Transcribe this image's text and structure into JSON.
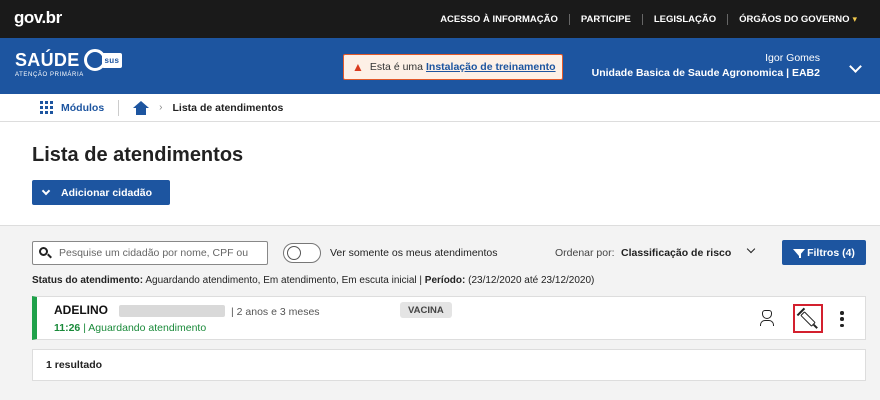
{
  "gov": {
    "logo": "gov.br",
    "links": [
      "ACESSO À INFORMAÇÃO",
      "PARTICIPE",
      "LEGISLAÇÃO",
      "ÓRGÃOS DO GOVERNO"
    ]
  },
  "brand": {
    "name": "SAÚDE",
    "esus": "sus",
    "subtitle": "ATENÇÃO PRIMÁRIA"
  },
  "training": {
    "prefix": "Esta é uma",
    "link": "Instalação de treinamento"
  },
  "user": {
    "name": "Igor Gomes",
    "unit": "Unidade Basica de Saude Agronomica | EAB2"
  },
  "breadcrumb": {
    "modules": "Módulos",
    "current": "Lista de atendimentos"
  },
  "page": {
    "title": "Lista de atendimentos",
    "add_button": "Adicionar cidadão"
  },
  "search": {
    "placeholder": "Pesquise um cidadão por nome, CPF ou"
  },
  "toggle": {
    "label": "Ver somente os meus atendimentos",
    "checked": false
  },
  "order": {
    "label": "Ordenar por:",
    "value": "Classificação de risco"
  },
  "filters": {
    "label": "Filtros (4)"
  },
  "status": {
    "status_label": "Status do atendimento:",
    "status_value": "Aguardando atendimento, Em atendimento, Em escuta inicial |",
    "period_label": "Período:",
    "period_value": "(23/12/2020 até 23/12/2020)"
  },
  "row": {
    "name": "ADELINO",
    "age": "|  2 anos e 3 meses",
    "time": "11:26",
    "state": "| Aguardando atendimento",
    "tag": "VACINA",
    "status_color": "#1fa14a"
  },
  "results": {
    "label": "1 resultado"
  },
  "colors": {
    "primary": "#1d55a0",
    "gov_bar": "#1a1a1a",
    "warning_border": "#e25a2b",
    "highlight": "#d3202e"
  }
}
